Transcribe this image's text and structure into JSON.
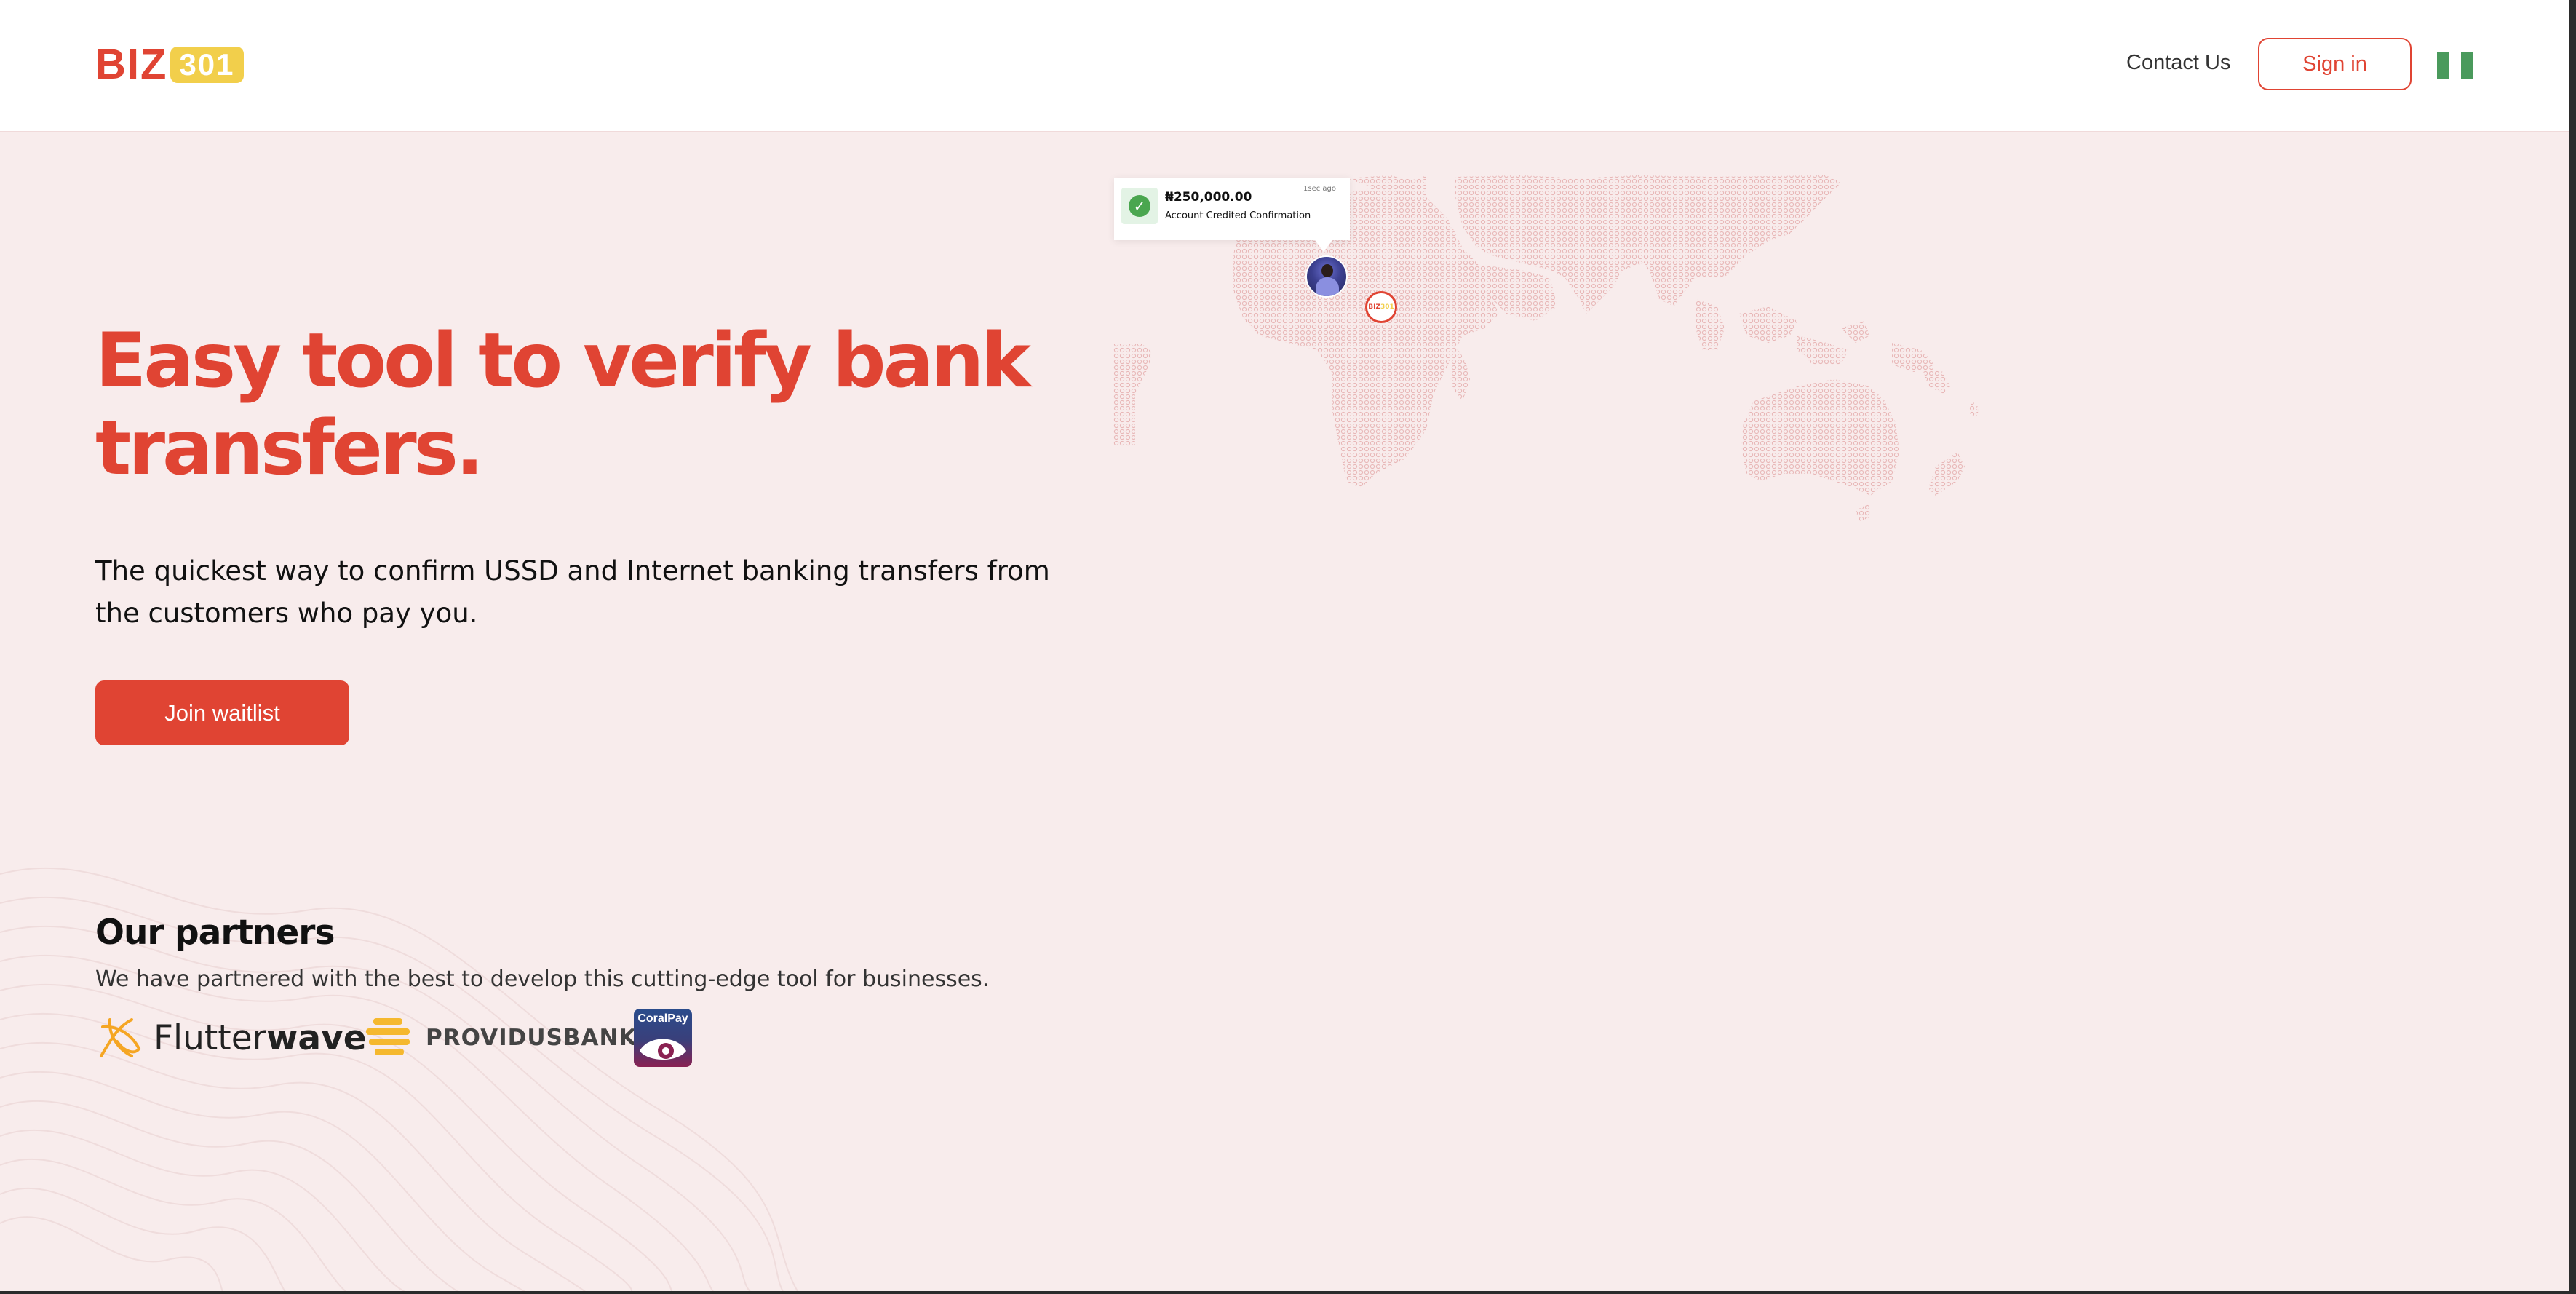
{
  "header": {
    "logo": {
      "text": "BIZ",
      "number": "301"
    },
    "nav": {
      "contact_label": "Contact Us",
      "signin_label": "Sign in"
    },
    "flag_icon": "nigeria-flag-icon"
  },
  "hero": {
    "headline": "Easy tool to verify bank transfers.",
    "subtext": "The quickest way to confirm USSD and Internet banking transfers from the customers who pay you.",
    "cta_label": "Join waitlist"
  },
  "notification": {
    "amount": "₦250,000.00",
    "label": "Account Credited Confirmation",
    "time": "1sec ago"
  },
  "map_pin": {
    "text": "BIZ",
    "number": "301"
  },
  "partners": {
    "title": "Our partners",
    "subtitle": "We have partnered with the best to develop this cutting-edge tool for businesses.",
    "logos": [
      {
        "name": "Flutterwave",
        "text_light": "Flutter",
        "text_bold": "wave",
        "color": "#f5a623"
      },
      {
        "name": "Providus Bank",
        "text": "PROVIDUSBANK",
        "color": "#f5b82e"
      },
      {
        "name": "CoralPay",
        "text": "CoralPay",
        "color": "#2a4c8c"
      }
    ]
  },
  "colors": {
    "brand_red": "#e04433",
    "brand_yellow": "#f2cf4b",
    "hero_bg": "#f8ecec",
    "map_dot": "#e8b8b8"
  }
}
